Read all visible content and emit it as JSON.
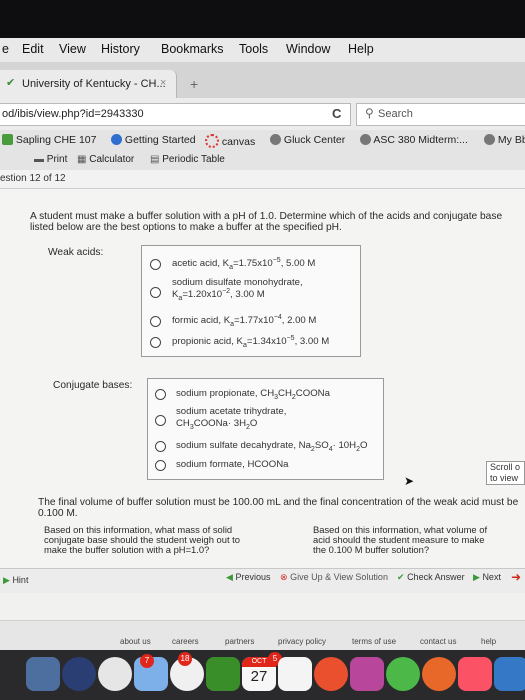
{
  "menu": [
    "e",
    "Edit",
    "View",
    "History",
    "Bookmarks",
    "Tools",
    "Window",
    "Help"
  ],
  "tab": {
    "title": "University of Kentucky - CH...",
    "close": "×",
    "new_tab": "+"
  },
  "nav": {
    "url": "od/ibis/view.php?id=2943330",
    "reload": "C",
    "search_placeholder": "Search"
  },
  "bookmarks": [
    {
      "label": "Sapling CHE 107"
    },
    {
      "label": "Getting Started"
    },
    {
      "label": "canvas"
    },
    {
      "label": "Gluck Center"
    },
    {
      "label": "ASC 380 Midterm:..."
    },
    {
      "label": "My Bb"
    }
  ],
  "tools": [
    {
      "label": "Print"
    },
    {
      "label": "Calculator"
    },
    {
      "label": "Periodic Table"
    }
  ],
  "question_header": "estion 12 of 12",
  "prompt": {
    "line1": "A student must make a buffer solution with a pH of 1.0. Determine which of the acids and conjugate base",
    "line2": "listed below are the best options to make a buffer at the specified pH."
  },
  "weak_acids": {
    "label": "Weak acids:",
    "options": [
      {
        "a": "acetic acid, K",
        "b": "a",
        "c": "=1.75x10",
        "d": "−5",
        "e": ", 5.00 M"
      },
      {
        "pre": "sodium disulfate monohydrate,",
        "a": "K",
        "b": "a",
        "c": "=1.20x10",
        "d": "−2",
        "e": ", 3.00 M"
      },
      {
        "a": "formic acid, K",
        "b": "a",
        "c": "=1.77x10",
        "d": "−4",
        "e": ", 2.00 M"
      },
      {
        "a": "propionic acid, K",
        "b": "a",
        "c": "=1.34x10",
        "d": "−5",
        "e": ", 3.00 M"
      }
    ]
  },
  "conjugate_bases": {
    "label": "Conjugate bases:",
    "options": [
      {
        "t1": "sodium propionate, CH",
        "s1": "3",
        "t2": "CH",
        "s2": "2",
        "t3": "COONa"
      },
      {
        "t1": "sodium acetate trihydrate,",
        "t2": "CH",
        "s2": "3",
        "t3": "COONa· 3H",
        "s3": "2",
        "t4": "O"
      },
      {
        "t1": "sodium sulfate decahydrate, Na",
        "s1": "2",
        "t2": "SO",
        "s2": "4",
        "t3": "· 10H",
        "s3": "2",
        "t4": "O"
      },
      {
        "t1": "sodium formate, HCOONa"
      }
    ]
  },
  "scroll_note": {
    "line1": "Scroll o",
    "line2": "to view"
  },
  "final_volume": {
    "line1": "The final volume of buffer solution must be 100.00 mL and the final concentration of the weak acid must be",
    "line2": "0.100 M."
  },
  "q_mass": {
    "line1": "Based on this information, what mass of solid",
    "line2": "conjugate base should the student weigh out to",
    "line3": "make the buffer solution with a pH=1.0?"
  },
  "q_volume": {
    "line1": "Based on this information, what volume of",
    "line2": "acid should the student measure to make",
    "line3": "the 0.100 M buffer solution?"
  },
  "actions": {
    "hint": "Hint",
    "previous": "Previous",
    "give_up": "Give Up & View Solution",
    "check": "Check Answer",
    "next": "Next"
  },
  "footer": [
    "about us",
    "careers",
    "partners",
    "privacy policy",
    "terms of use",
    "contact us",
    "help"
  ],
  "dock": {
    "calendar_month": "OCT",
    "calendar_day": "27",
    "badge_a": "7",
    "badge_b": "18",
    "badge_c": "5"
  },
  "colors": {
    "accent_green": "#3a9a3a",
    "give_up_red": "#d0332f",
    "next_red": "#cc2a1c"
  }
}
